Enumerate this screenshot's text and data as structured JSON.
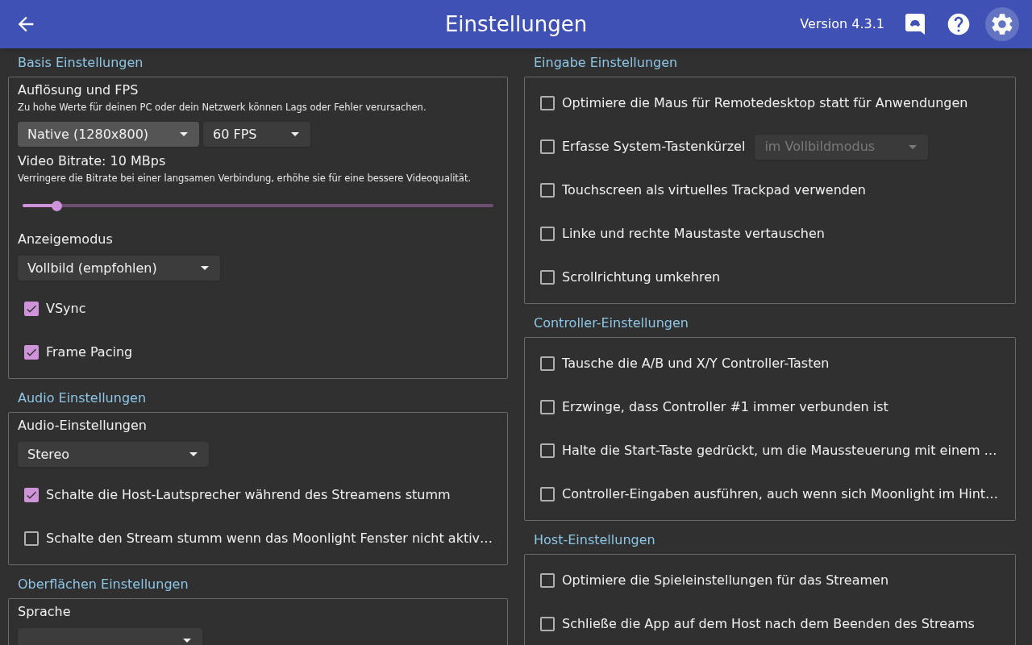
{
  "header": {
    "title": "Einstellungen",
    "version": "Version 4.3.1"
  },
  "left": [
    {
      "title": "Basis Einstellungen",
      "items": [
        {
          "kind": "label",
          "text": "Auflösung und FPS"
        },
        {
          "kind": "hint",
          "text": "Zu hohe Werte für deinen PC oder dein Netzwerk können Lags oder Fehler verursachen."
        },
        {
          "kind": "dropdowns",
          "dropdowns": [
            {
              "value": "Native (1280x800)",
              "focused": true,
              "disabled": false
            },
            {
              "value": "60 FPS",
              "focused": false,
              "disabled": false
            }
          ]
        },
        {
          "kind": "label",
          "text": "Video Bitrate: 10 MBps"
        },
        {
          "kind": "hint",
          "text": "Verringere die Bitrate bei einer langsamen Verbindung, erhöhe sie für eine bessere Videoqualität."
        },
        {
          "kind": "slider",
          "level": 0.073
        },
        {
          "kind": "label",
          "text": "Anzeigemodus"
        },
        {
          "kind": "dropdowns",
          "dropdowns": [
            {
              "value": "Vollbild (empfohlen)",
              "focused": false,
              "disabled": false
            }
          ]
        },
        {
          "kind": "checkbox",
          "text": "VSync",
          "checked": true
        },
        {
          "kind": "checkbox",
          "text": "Frame Pacing",
          "checked": true
        }
      ]
    },
    {
      "title": "Audio Einstellungen",
      "items": [
        {
          "kind": "label",
          "text": "Audio-Einstellungen"
        },
        {
          "kind": "dropdowns",
          "dropdowns": [
            {
              "value": "Stereo",
              "focused": false,
              "disabled": false
            }
          ]
        },
        {
          "kind": "checkbox",
          "text": "Schalte die Host-Lautsprecher während des Streamens stumm",
          "checked": true
        },
        {
          "kind": "checkbox",
          "text": "Schalte den Stream stumm wenn das Moonlight Fenster nicht aktiv…",
          "checked": false
        }
      ]
    },
    {
      "title": "Oberflächen Einstellungen",
      "items": [
        {
          "kind": "label",
          "text": "Sprache"
        },
        {
          "kind": "dropdowns",
          "dropdowns": [
            {
              "focused": false,
              "disabled": false
            }
          ]
        }
      ]
    }
  ],
  "right": [
    {
      "title": "Eingabe Einstellungen",
      "items": [
        {
          "kind": "checkbox",
          "text": "Optimiere die Maus für Remotedesktop statt für Anwendungen",
          "checked": false
        },
        {
          "kind": "checkbox",
          "text": "Erfasse System-Tastenkürzel",
          "checked": false,
          "dropdown": {
            "value": "im Vollbildmodus",
            "disabled": true
          }
        },
        {
          "kind": "checkbox",
          "text": "Touchscreen als virtuelles Trackpad verwenden",
          "checked": false
        },
        {
          "kind": "checkbox",
          "text": "Linke und rechte Maustaste vertauschen",
          "checked": false
        },
        {
          "kind": "checkbox",
          "text": "Scrollrichtung umkehren",
          "checked": false
        }
      ]
    },
    {
      "title": "Controller-Einstellungen",
      "items": [
        {
          "kind": "checkbox",
          "text": "Tausche die A/B und X/Y Controller-Tasten",
          "checked": false
        },
        {
          "kind": "checkbox",
          "text": "Erzwinge, dass Controller #1 immer verbunden ist",
          "checked": false
        },
        {
          "kind": "checkbox",
          "text": "Halte die Start-Taste gedrückt, um die Maussteuerung mit einem …",
          "checked": false
        },
        {
          "kind": "checkbox",
          "text": "Controller-Eingaben ausführen, auch wenn sich Moonlight im Hint…",
          "checked": false
        }
      ]
    },
    {
      "title": "Host-Einstellungen",
      "items": [
        {
          "kind": "checkbox",
          "text": "Optimiere die Spieleinstellungen für das Streamen",
          "checked": false
        },
        {
          "kind": "checkbox",
          "text": "Schließe die App auf dem Host nach dem Beenden des Streams",
          "checked": false
        }
      ]
    }
  ]
}
